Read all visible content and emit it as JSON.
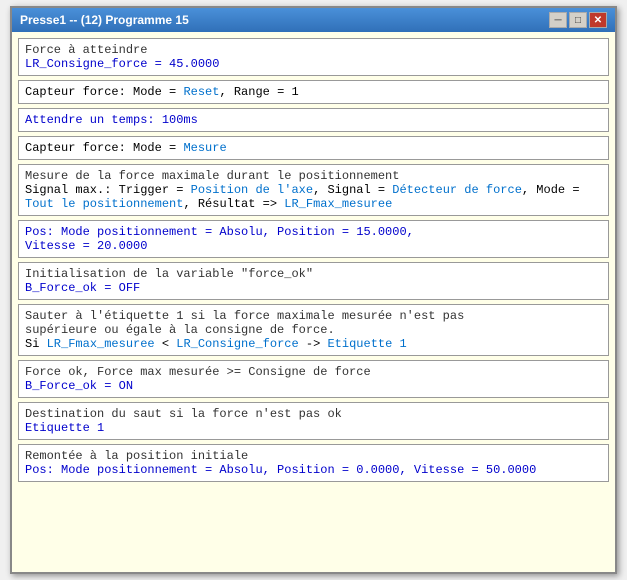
{
  "window": {
    "title": "Presse1 -- (12) Programme 15",
    "minimize_label": "─",
    "restore_label": "□",
    "close_label": "✕"
  },
  "blocks": [
    {
      "id": "block1",
      "comment": "Force à atteindre",
      "code": "LR_Consigne_force = 45.0000",
      "code_color": "blue"
    },
    {
      "id": "block2",
      "comment": null,
      "code": "Capteur force: Mode = Reset, Range = 1",
      "code_color": "mixed_reset"
    },
    {
      "id": "block3",
      "comment": null,
      "code": "Attendre un temps: 100ms",
      "code_color": "blue"
    },
    {
      "id": "block4",
      "comment": null,
      "code": "Capteur force: Mode = Mesure",
      "code_color": "mixed_mesure"
    },
    {
      "id": "block5",
      "comment": "Mesure de la force maximale durant le positionnement",
      "code": "Signal max.: Trigger = Position de l'axe, Signal = Détecteur de force, Mode = Tout le positionnement, Résultat => LR_Fmax_mesuree",
      "code_color": "mixed_signal"
    },
    {
      "id": "block6",
      "comment": null,
      "code": "Pos: Mode positionnement = Absolu, Position = 15.0000,\nVitesse = 20.0000",
      "code_color": "blue"
    },
    {
      "id": "block7",
      "comment": "Initialisation de la variable \"force_ok\"",
      "code": "B_Force_ok = OFF",
      "code_color": "blue"
    },
    {
      "id": "block8",
      "comment": "Sauter à l'étiquette 1 si la force maximale mesurée n'est pas\nsupérieure ou égale à la consigne de force.",
      "code": "Si LR_Fmax_mesuree < LR_Consigne_force -> Etiquette 1",
      "code_color": "mixed_si"
    },
    {
      "id": "block9",
      "comment": "Force ok, Force max mesurée >= Consigne de force",
      "code": "B_Force_ok = ON",
      "code_color": "blue"
    },
    {
      "id": "block10",
      "comment": "Destination du saut si la force n'est pas ok",
      "code": "Etiquette 1",
      "code_color": "blue"
    },
    {
      "id": "block11",
      "comment": "Remontée à la position initiale",
      "code": "Pos: Mode positionnement = Absolu, Position = 0.0000, Vitesse = 50.0000",
      "code_color": "blue"
    }
  ]
}
